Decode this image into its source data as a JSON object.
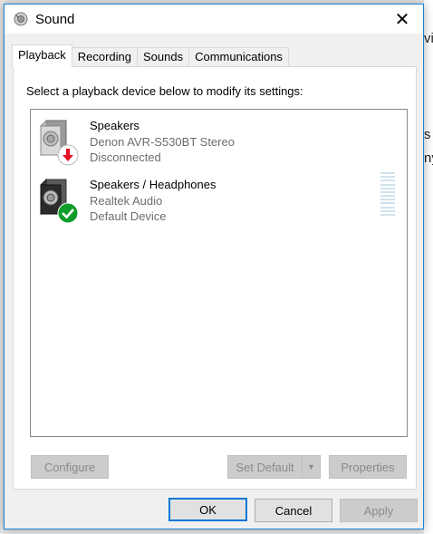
{
  "window": {
    "title": "Sound",
    "close_glyph": "✕",
    "title_icon": "speaker-icon"
  },
  "tabs": [
    {
      "label": "Playback",
      "active": true
    },
    {
      "label": "Recording",
      "active": false
    },
    {
      "label": "Sounds",
      "active": false
    },
    {
      "label": "Communications",
      "active": false
    }
  ],
  "playback": {
    "instruction": "Select a playback device below to modify its settings:",
    "devices": [
      {
        "name": "Speakers",
        "description": "Denon AVR-S530BT Stereo",
        "status": "Disconnected",
        "badge": "red-down-arrow",
        "badge_color": "#e81123"
      },
      {
        "name": "Speakers / Headphones",
        "description": "Realtek Audio",
        "status": "Default Device",
        "badge": "green-check",
        "badge_color": "#0f9d2a"
      }
    ],
    "buttons": {
      "configure": "Configure",
      "set_default": "Set Default",
      "properties": "Properties"
    }
  },
  "footer": {
    "ok": "OK",
    "cancel": "Cancel",
    "apply": "Apply"
  }
}
